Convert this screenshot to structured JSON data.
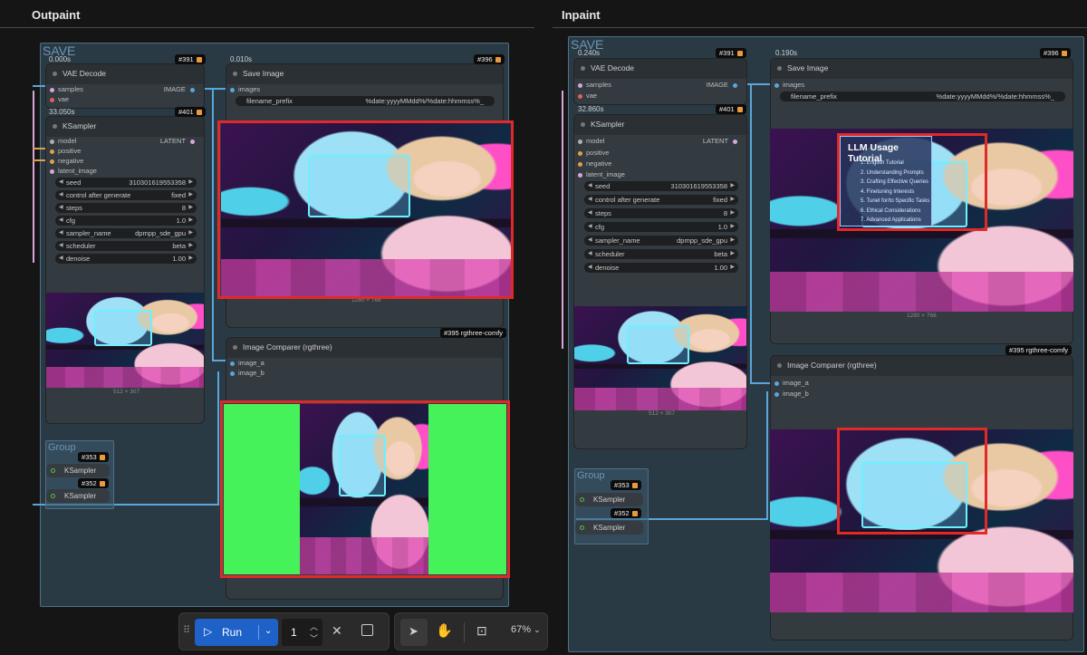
{
  "sections": {
    "left_title": "Outpaint",
    "right_title": "Inpaint"
  },
  "left": {
    "group_title": "SAVE",
    "vae_decode": {
      "timing": "0.000s",
      "id": "#391",
      "title": "VAE Decode",
      "inputs": [
        "samples",
        "vae"
      ],
      "output": "IMAGE"
    },
    "save_image": {
      "timing": "0.010s",
      "id": "#396",
      "title": "Save Image",
      "input": "images",
      "widget_label": "filename_prefix",
      "widget_value": "%date:yyyyMMdd%/%date:hhmmss%_",
      "image_size": "1280 × 768"
    },
    "ksampler": {
      "timing": "33.050s",
      "id": "#401",
      "title": "KSampler",
      "inputs": [
        "model",
        "positive",
        "negative",
        "latent_image"
      ],
      "output": "LATENT",
      "widgets": [
        {
          "label": "seed",
          "value": "310301619553358"
        },
        {
          "label": "control after generate",
          "value": "fixed"
        },
        {
          "label": "steps",
          "value": "8"
        },
        {
          "label": "cfg",
          "value": "1.0"
        },
        {
          "label": "sampler_name",
          "value": "dpmpp_sde_gpu"
        },
        {
          "label": "scheduler",
          "value": "beta"
        },
        {
          "label": "denoise",
          "value": "1.00"
        }
      ],
      "image_size": "512 × 307"
    },
    "comparer": {
      "id": "#395 rgthree-comfy",
      "title": "Image Comparer (rgthree)",
      "inputs": [
        "image_a",
        "image_b"
      ]
    },
    "group": {
      "title": "Group",
      "nodes": [
        {
          "id": "#353",
          "label": "KSampler"
        },
        {
          "id": "#352",
          "label": "KSampler"
        }
      ]
    }
  },
  "right": {
    "group_title": "SAVE",
    "vae_decode": {
      "timing": "0.240s",
      "id": "#391",
      "title": "VAE Decode",
      "inputs": [
        "samples",
        "vae"
      ],
      "output": "IMAGE"
    },
    "save_image": {
      "timing": "0.190s",
      "id": "#396",
      "title": "Save Image",
      "input": "images",
      "widget_label": "filename_prefix",
      "widget_value": "%date:yyyyMMdd%/%date:hhmmss%_",
      "image_size": "1280 × 768"
    },
    "ksampler": {
      "timing": "32.860s",
      "id": "#401",
      "title": "KSampler",
      "inputs": [
        "model",
        "positive",
        "negative",
        "latent_image"
      ],
      "output": "LATENT",
      "widgets": [
        {
          "label": "seed",
          "value": "310301619553358"
        },
        {
          "label": "control after generate",
          "value": "fixed"
        },
        {
          "label": "steps",
          "value": "8"
        },
        {
          "label": "cfg",
          "value": "1.0"
        },
        {
          "label": "sampler_name",
          "value": "dpmpp_sde_gpu"
        },
        {
          "label": "scheduler",
          "value": "beta"
        },
        {
          "label": "denoise",
          "value": "1.00"
        }
      ],
      "image_size": "512 × 307"
    },
    "comparer": {
      "id": "#395 rgthree-comfy",
      "title": "Image Comparer (rgthree)",
      "inputs": [
        "image_a",
        "image_b"
      ]
    },
    "group": {
      "title": "Group",
      "nodes": [
        {
          "id": "#353",
          "label": "KSampler"
        },
        {
          "id": "#352",
          "label": "KSampler"
        }
      ]
    },
    "llm_panel": {
      "title": "LLM Usage Tutorial",
      "items": [
        "1. English Tutorial",
        "2. Understanding Prompts",
        "3. Crafting Effective Queries",
        "4. Finetuning Interests",
        "5. Tunel for/to Specific Tasks",
        "6. Ethical Considerations",
        "7. Advanced Applications"
      ]
    }
  },
  "toolbar": {
    "run_label": "Run",
    "count": "1",
    "zoom": "67%"
  },
  "colors": {
    "accent": "#1e62c9",
    "wire": "#5aa6d8",
    "highlight": "#e02a2a",
    "fill_green": "#46f25a"
  }
}
